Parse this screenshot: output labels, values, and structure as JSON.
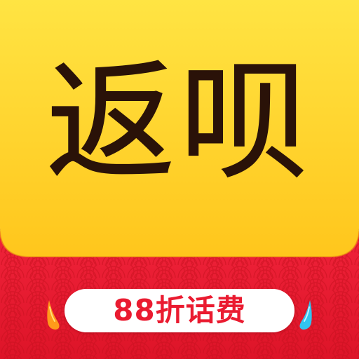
{
  "app_icon": {
    "title": "返呗",
    "promo_label": "88折话费"
  },
  "colors": {
    "yellow_top": "#ffe443",
    "yellow_bottom": "#ffc61c",
    "text_dark": "#2a1208",
    "banner_red": "#ea1b30",
    "banner_dark_red": "#c8101f",
    "pill_white": "#ffffff",
    "accent_orange": "#ff9a1a",
    "accent_blue": "#31c4f0"
  },
  "icons": {
    "left_spark": "water-drop-orange",
    "right_spark": "water-drop-blue",
    "pattern": "seigaiha-wave-pattern"
  }
}
